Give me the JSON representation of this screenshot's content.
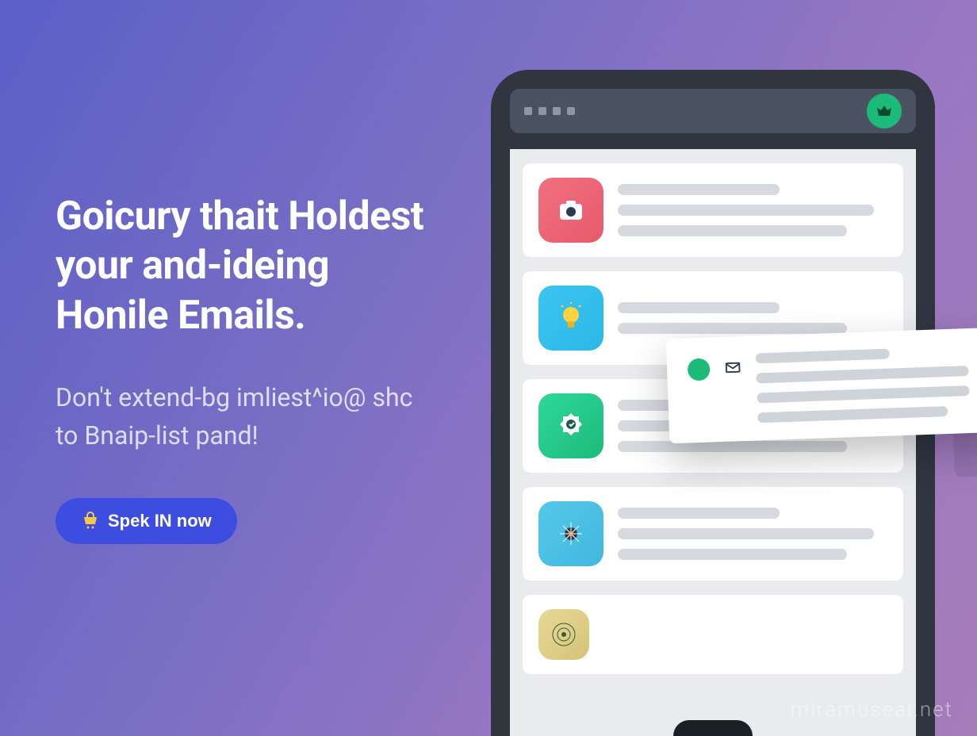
{
  "hero": {
    "headline": "Goicury thait Holdest your and-ideing Honile Emails.",
    "subhead": "Don't extend-bg imliest^io@ shc to Bnaip-list pand!",
    "cta_label": "Spek IN now"
  },
  "device": {
    "cards": [
      {
        "icon_color": "pink",
        "icon_name": "camera-app-icon"
      },
      {
        "icon_color": "blue",
        "icon_name": "lightbulb-app-icon"
      },
      {
        "icon_color": "green",
        "icon_name": "badge-app-icon"
      },
      {
        "icon_color": "lightblue",
        "icon_name": "snowflake-app-icon"
      },
      {
        "icon_color": "gold",
        "icon_name": "pattern-app-icon"
      }
    ],
    "popup": {
      "indicator": "unread",
      "icon": "mail"
    }
  },
  "watermark": "miramuseai.net"
}
